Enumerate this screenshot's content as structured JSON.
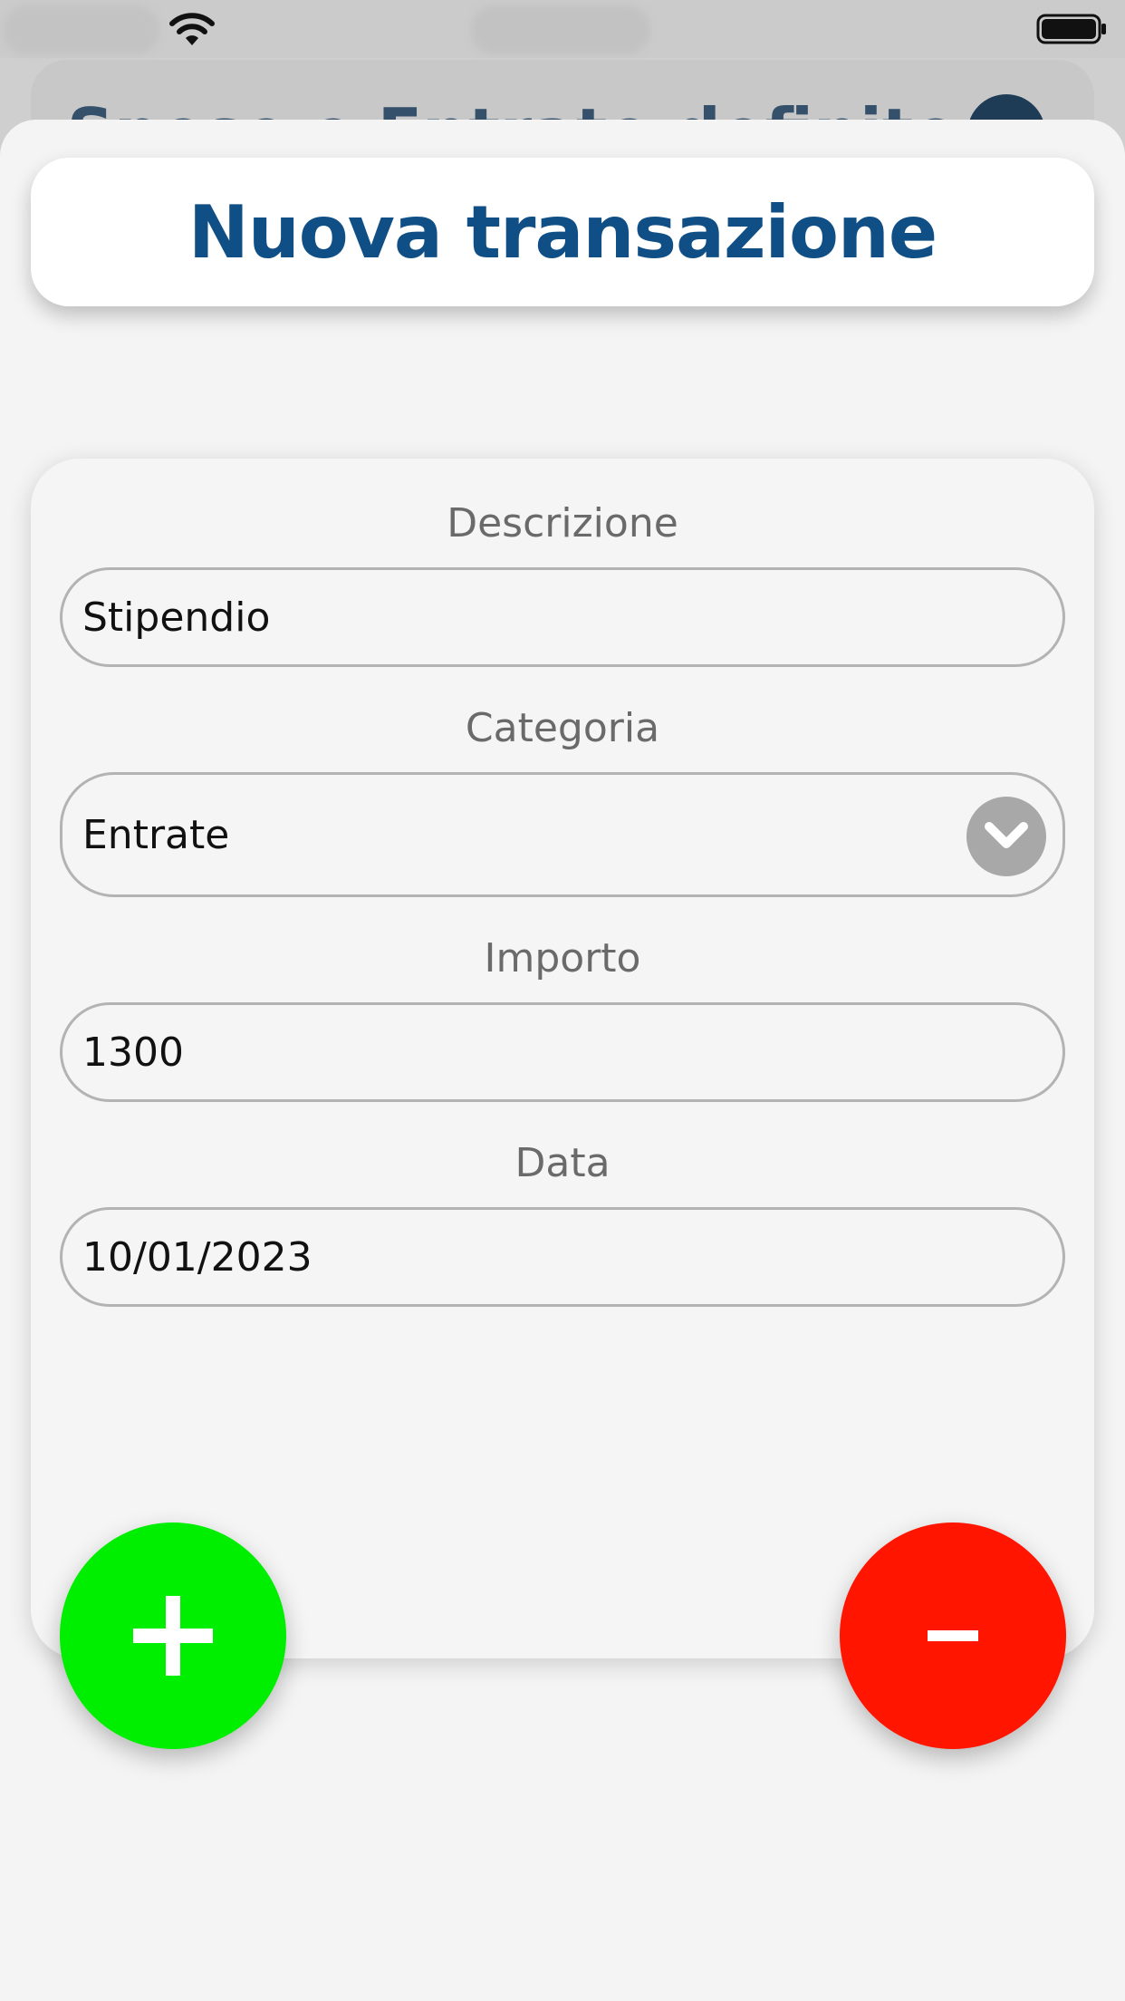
{
  "background_header": {
    "title": "Spese e Entrate definite"
  },
  "sheet": {
    "title": "Nuova transazione"
  },
  "form": {
    "description": {
      "label": "Descrizione",
      "value": "Stipendio"
    },
    "category": {
      "label": "Categoria",
      "value": "Entrate",
      "icon": "chevron-down-icon"
    },
    "amount": {
      "label": "Importo",
      "value": "1300"
    },
    "date": {
      "label": "Data",
      "value": "10/01/2023"
    }
  },
  "buttons": {
    "add": {
      "icon": "plus-icon",
      "color": "#00ee00"
    },
    "subtract": {
      "icon": "minus-icon",
      "color": "#ff1500"
    }
  },
  "colors": {
    "title": "#0f4f86",
    "sheet_bg": "#f4f4f4"
  }
}
